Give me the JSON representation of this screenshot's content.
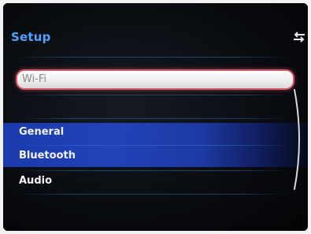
{
  "header": {
    "title": "Setup",
    "back_icon": "back-arrows-icon"
  },
  "menu": {
    "items": [
      {
        "label": "Wi-Fi",
        "state": "focused"
      },
      {
        "label": "General",
        "state": "highlighted"
      },
      {
        "label": "Bluetooth",
        "state": "highlighted"
      },
      {
        "label": "Audio",
        "state": "normal"
      }
    ]
  },
  "colors": {
    "title": "#4fa3ff",
    "focus_ring": "#d25a66",
    "highlight": "#2446c8",
    "background": "#07090d"
  }
}
